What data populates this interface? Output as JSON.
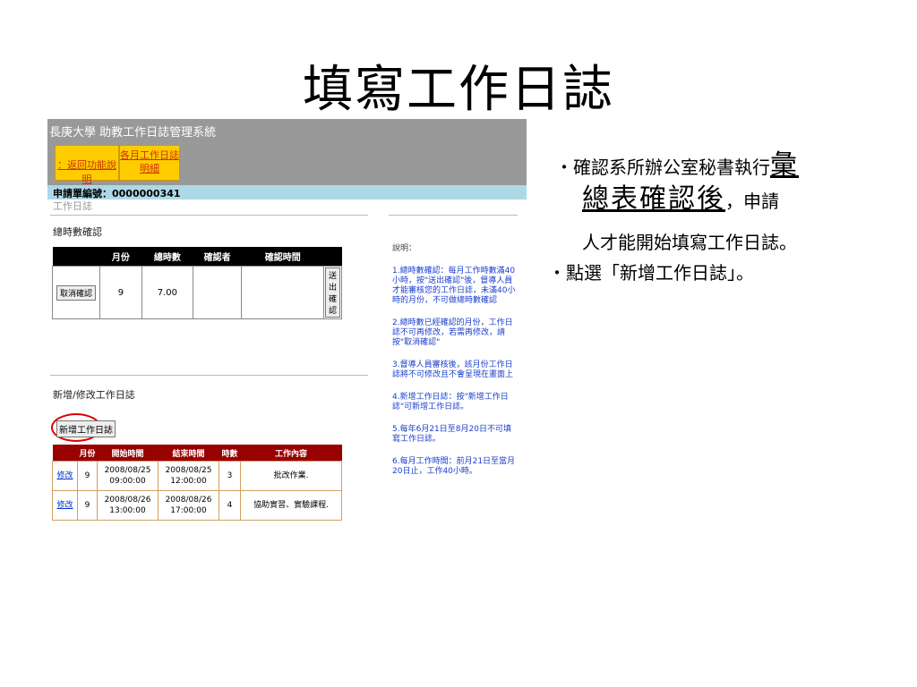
{
  "slide": {
    "title": "填寫工作日誌",
    "bullet1_prefix": "‧確認系所辦公室秘書執行",
    "bullet1_emph_part1": "彙",
    "bullet1_emph_part2": "總表確認後",
    "bullet1_suffix": "，申請",
    "bullet1_line3": "人才能開始填寫工作日誌。",
    "bullet2": "‧點選「新增工作日誌」。"
  },
  "app": {
    "system_title": "長庚大學 助教工作日誌管理系統",
    "tabs": [
      "：返回功能說明",
      "各月工作日誌明細"
    ],
    "application_no_label": "申請單編號：",
    "application_no": "0000000341",
    "section_label": "工作日誌",
    "hours_confirm_title": "總時數確認",
    "hours_table": {
      "headers": [
        "",
        "月份",
        "總時數",
        "確認者",
        "確認時間",
        ""
      ],
      "row": {
        "cancel_button": "取消確認",
        "month": "9",
        "total_hours": "7.00",
        "confirmer": "",
        "confirm_time": "",
        "send_button": "送出確認"
      }
    },
    "edit_section_title": "新增/修改工作日誌",
    "new_log_button": "新增工作日誌",
    "log_table": {
      "headers": [
        "",
        "月份",
        "開始時間",
        "結束時間",
        "時數",
        "工作內容"
      ],
      "rows": [
        {
          "action": "修改",
          "month": "9",
          "start": "2008/08/25 09:00:00",
          "end": "2008/08/25 12:00:00",
          "hours": "3",
          "content": "批改作業."
        },
        {
          "action": "修改",
          "month": "9",
          "start": "2008/08/26 13:00:00",
          "end": "2008/08/26 17:00:00",
          "hours": "4",
          "content": "協助實習、實驗課程."
        }
      ]
    },
    "notes": {
      "heading": "說明：",
      "items": [
        "1.總時數確認：每月工作時數滿40小時，按\"送出確認\"後，督導人員才能審核您的工作日誌，未滿40小時的月份，不可做總時數確認",
        "2.總時數已經確認的月份，工作日誌不可再修改，若需再修改，請按\"取消確認\"",
        "3.督導人員審核後，該月份工作日誌將不可修改且不會呈現在畫面上",
        "4.新增工作日誌：按\"新增工作日誌\"可新增工作日誌。",
        "5.每年6月21日至8月20日不可填寫工作日誌。",
        "6.每月工作時間：前月21日至當月20日止，工作40小時。"
      ]
    }
  },
  "colors": {
    "header_gray": "#999999",
    "tab_yellow": "#ffcc00",
    "app_bar_blue": "#add8e6",
    "log_header_red": "#990000",
    "highlight_circle": "#dd0000",
    "notes_blue": "#1a3fcc"
  }
}
